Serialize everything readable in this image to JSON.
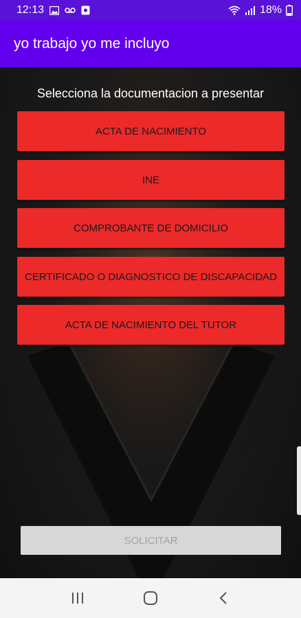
{
  "status_bar": {
    "time": "12:13",
    "battery": "18%",
    "icons": [
      "image-icon",
      "voicemail-icon",
      "app-notification-icon",
      "wifi-icon",
      "signal-icon",
      "battery-icon"
    ]
  },
  "app_bar": {
    "title": "yo trabajo yo me incluyo",
    "color": "#6200ee"
  },
  "main": {
    "prompt": "Selecciona la documentacion a presentar",
    "documents": [
      {
        "label": "ACTA DE NACIMIENTO"
      },
      {
        "label": "INE"
      },
      {
        "label": "COMPROBANTE DE DOMICILIO"
      },
      {
        "label": "CERTIFICADO O DIAGNOSTICO DE DISCAPACIDAD"
      },
      {
        "label": "ACTA DE NACIMIENTO DEL TUTOR"
      }
    ],
    "button_color": "#ec2a2a",
    "submit_label": "SOLICITAR"
  },
  "nav_bar": {
    "icons": [
      "recent-apps-icon",
      "home-icon",
      "back-icon"
    ]
  }
}
